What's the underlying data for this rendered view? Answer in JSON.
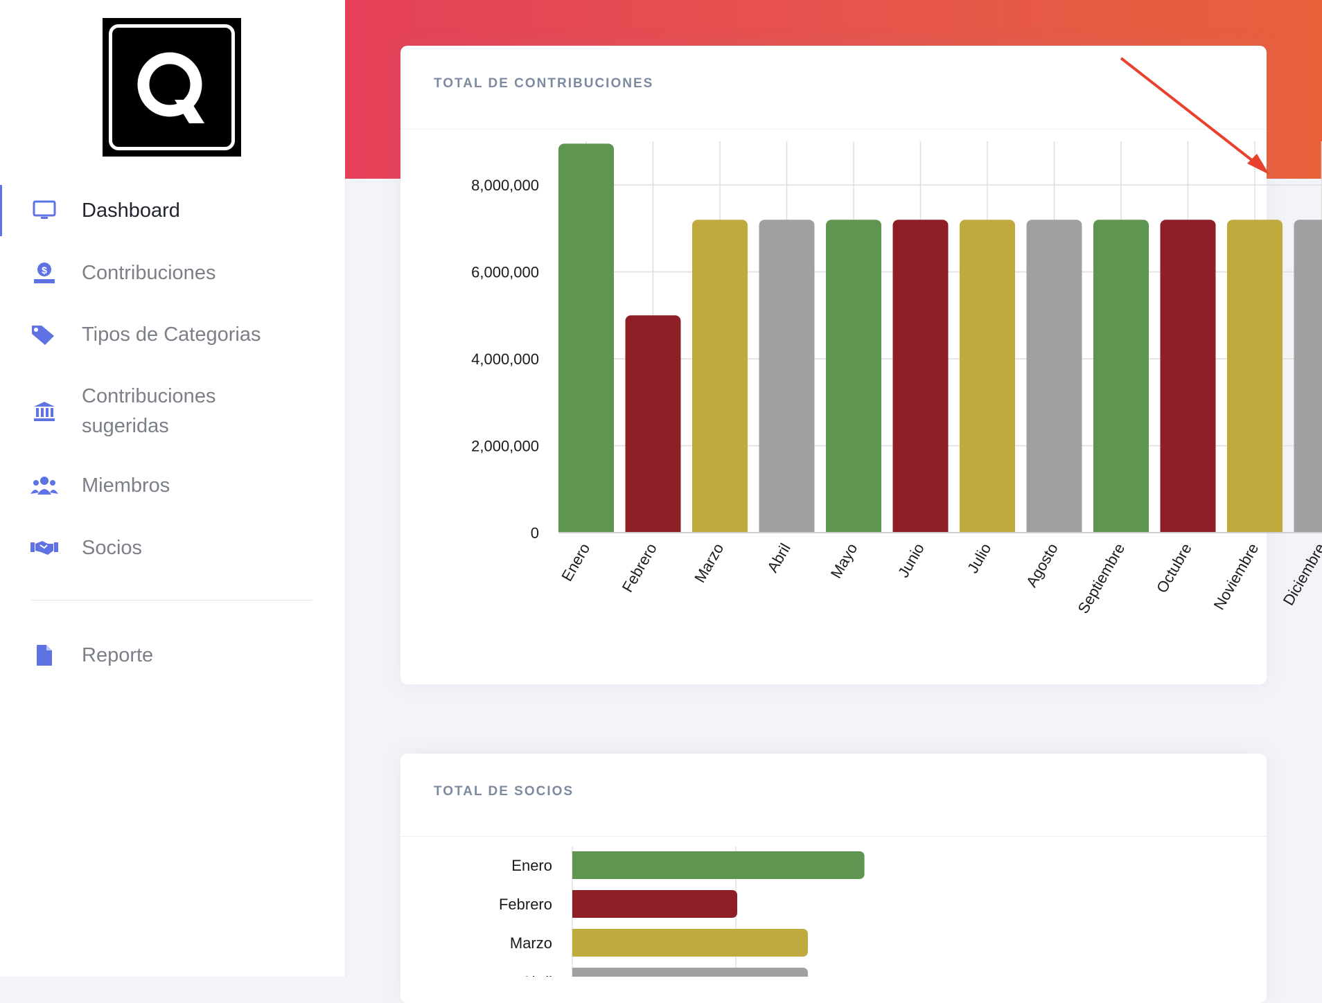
{
  "sidebar": {
    "logo_letter": "Q",
    "items": [
      {
        "label": "Dashboard",
        "icon": "monitor-icon",
        "active": true
      },
      {
        "label": "Contribuciones",
        "icon": "donate-icon"
      },
      {
        "label": "Tipos de Categorias",
        "icon": "tags-icon"
      },
      {
        "label": "Contribuciones\nsugeridas",
        "icon": "bank-icon"
      },
      {
        "label": "Miembros",
        "icon": "users-icon"
      },
      {
        "label": "Socios",
        "icon": "handshake-icon"
      },
      {
        "label": "Reporte",
        "icon": "file-icon"
      }
    ]
  },
  "colors": {
    "accent": "#5e72e4",
    "green": "#5e9651",
    "red": "#8e1f27",
    "yellow": "#c0a93d",
    "grey": "#a0a0a0",
    "header_from": "#e5405a",
    "header_to": "#e9603b"
  },
  "cards": {
    "contrib_title": "TOTAL DE CONTRIBUCIONES",
    "socios_title": "TOTAL DE SOCIOS"
  },
  "chart_data": [
    {
      "type": "bar",
      "title": "TOTAL DE CONTRIBUCIONES",
      "categories": [
        "Enero",
        "Febrero",
        "Marzo",
        "Abril",
        "Mayo",
        "Junio",
        "Julio",
        "Agosto",
        "Septiembre",
        "Octubre",
        "Noviembre",
        "Diciembre"
      ],
      "values": [
        8950000,
        5000000,
        7200000,
        7200000,
        7200000,
        7200000,
        7200000,
        7200000,
        7200000,
        7200000,
        7200000,
        7200000
      ],
      "colors": [
        "#5e9651",
        "#8e1f27",
        "#c0a93d",
        "#a0a0a0",
        "#5e9651",
        "#8e1f27",
        "#c0a93d",
        "#a0a0a0",
        "#5e9651",
        "#8e1f27",
        "#c0a93d",
        "#a0a0a0"
      ],
      "y_ticks": [
        "0",
        "2,000,000",
        "4,000,000",
        "6,000,000",
        "8,000,000"
      ],
      "ylim": [
        0,
        9000000
      ],
      "grid": true,
      "xlabel": "",
      "ylabel": ""
    },
    {
      "type": "bar",
      "orientation": "horizontal",
      "title": "TOTAL DE SOCIOS",
      "categories": [
        "Enero",
        "Febrero",
        "Marzo",
        "Abril"
      ],
      "values": [
        0.62,
        0.35,
        0.5,
        0.5
      ],
      "colors": [
        "#5e9651",
        "#8e1f27",
        "#c0a93d",
        "#a0a0a0"
      ],
      "grid": true
    }
  ]
}
